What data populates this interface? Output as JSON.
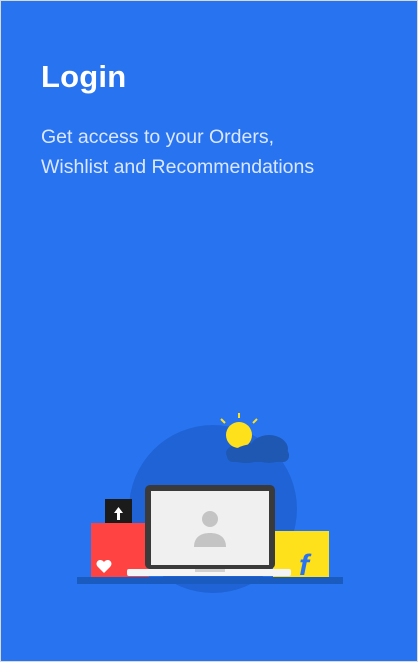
{
  "panel": {
    "title": "Login",
    "subtitle_line1": "Get access to your Orders,",
    "subtitle_line2": "Wishlist and Recommendations"
  },
  "illustration": {
    "laptop_icon": "user-avatar-icon",
    "heart_icon": "heart-icon",
    "arrow_icon": "upload-arrow-icon",
    "brand_mark": "f",
    "colors": {
      "background": "#2874f0",
      "red_bag": "#ff4343",
      "yellow_bag": "#ffe11b",
      "sun": "#ffe11b",
      "cloud": "#1f58b3",
      "laptop_frame": "#3a3a3a",
      "screen": "#f0f0f0",
      "avatar": "#c4c4c4"
    }
  }
}
